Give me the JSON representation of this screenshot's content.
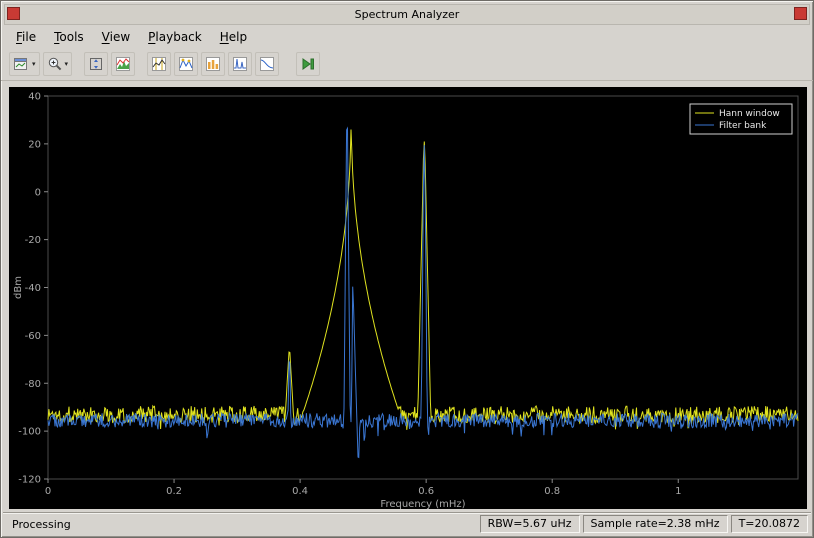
{
  "window": {
    "title": "Spectrum Analyzer"
  },
  "menu": {
    "items": [
      {
        "label": "File"
      },
      {
        "label": "Tools"
      },
      {
        "label": "View"
      },
      {
        "label": "Playback"
      },
      {
        "label": "Help"
      }
    ]
  },
  "toolbar": {
    "buttons": [
      {
        "icon": "export-scope-icon",
        "dropdown": true
      },
      {
        "icon": "zoom-in-icon",
        "dropdown": true
      },
      {
        "icon": "fit-to-view-icon",
        "dropdown": false
      },
      {
        "icon": "spectrum-settings-icon",
        "dropdown": false
      },
      {
        "icon": "cursor-measurements-icon",
        "dropdown": false
      },
      {
        "icon": "peak-finder-icon",
        "dropdown": false
      },
      {
        "icon": "channel-measurements-icon",
        "dropdown": false
      },
      {
        "icon": "distortion-measurements-icon",
        "dropdown": false
      },
      {
        "icon": "ccdf-measurements-icon",
        "dropdown": false
      },
      {
        "icon": "step-forward-icon",
        "dropdown": false
      }
    ]
  },
  "status": {
    "left": "Processing",
    "rbw": "RBW=5.67 uHz",
    "sample_rate": "Sample rate=2.38 mHz",
    "time": "T=20.0872"
  },
  "chart_data": {
    "type": "line",
    "title": "",
    "xlabel": "Frequency (mHz)",
    "ylabel": "dBm",
    "xlim": [
      0,
      1.19
    ],
    "ylim": [
      -120,
      40
    ],
    "xticks": [
      0,
      0.2,
      0.4,
      0.6,
      0.8,
      1
    ],
    "xtick_labels": [
      "0",
      "0.2",
      "0.4",
      "0.6",
      "0.8",
      "1"
    ],
    "yticks": [
      40,
      20,
      0,
      -20,
      -40,
      -60,
      -80,
      -100,
      -120
    ],
    "ytick_labels": [
      "40",
      "20",
      "0",
      "-20",
      "-40",
      "-60",
      "-80",
      "-100",
      "-120"
    ],
    "grid": false,
    "background": "#000000",
    "legend_position": "northeast",
    "series": [
      {
        "name": "Hann window",
        "color": "#e0e31f",
        "seed": 1337,
        "noise_floor": -93,
        "noise_amp": 3.5,
        "peaks": [
          {
            "x": 0.383,
            "amp": -67,
            "shape": "linear",
            "slope": 4500
          },
          {
            "x": 0.481,
            "amp": 26,
            "shape": "skirt",
            "c": 430
          },
          {
            "x": 0.597,
            "amp": 21,
            "shape": "linear",
            "slope": 12000
          }
        ],
        "dips": []
      },
      {
        "name": "Filter bank",
        "color": "#3a76d2",
        "seed": 777,
        "noise_floor": -95.5,
        "noise_amp": 3,
        "peaks": [
          {
            "x": 0.383,
            "amp": -71,
            "shape": "linear",
            "slope": 15000
          },
          {
            "x": 0.4745,
            "amp": 26.5,
            "shape": "linear",
            "slope": 28000
          },
          {
            "x": 0.4865,
            "amp": 25.5,
            "shape": "linear",
            "slope": 28000
          },
          {
            "x": 0.597,
            "amp": 19.5,
            "shape": "linear",
            "slope": 28000
          }
        ],
        "dips": [
          {
            "x": 0.4925,
            "depth": -111,
            "slope": 9000
          },
          {
            "x": 0.502,
            "depth": -104,
            "slope": 9000
          }
        ]
      }
    ]
  }
}
